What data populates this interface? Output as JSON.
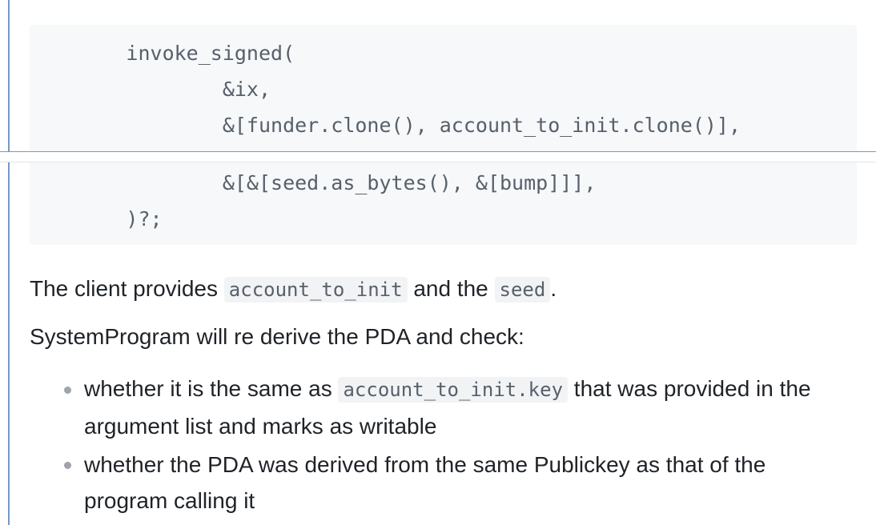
{
  "code_block": {
    "lines": [
      "        invoke_signed(",
      "                &ix,",
      "                &[funder.clone(), account_to_init.clone()],",
      "                &[&[seed.as_bytes(), &[bump]]],",
      "        )?;"
    ]
  },
  "paragraph1": {
    "prefix": "The client provides ",
    "code1": "account_to_init",
    "middle": " and the ",
    "code2": "seed",
    "suffix": "."
  },
  "paragraph2": {
    "text": "SystemProgram will re derive the PDA and check:"
  },
  "bullets": [
    {
      "prefix": "whether it is the same as ",
      "code": "account_to_init.key",
      "suffix": " that was provided in the argument list and marks as writable"
    },
    {
      "text": "whether the PDA was derived from the same Publickey as that of the program calling it"
    }
  ]
}
